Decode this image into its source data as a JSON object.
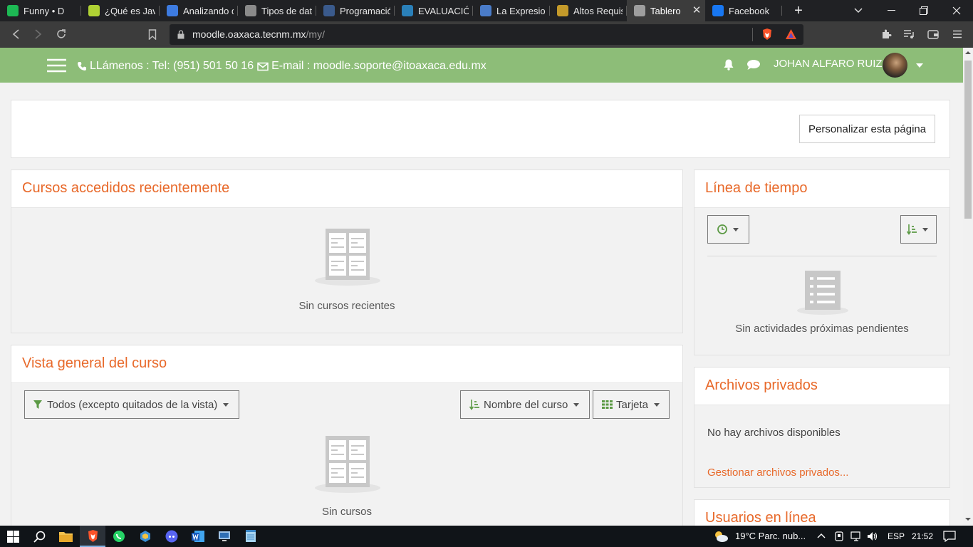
{
  "browser": {
    "tabs": [
      {
        "title": "Funny • D",
        "favicon": "spotify-icon",
        "color": "#1db954"
      },
      {
        "title": "¿Qué es JavaS",
        "favicon": "diamond-icon",
        "color": "#b0d234"
      },
      {
        "title": "Analizando di",
        "favicon": "s-logo-icon",
        "color": "#3d7be0"
      },
      {
        "title": "Tipos de dato",
        "favicon": "globe-icon",
        "color": "#8a8a8a"
      },
      {
        "title": "Programación",
        "favicon": "page-icon",
        "color": "#3a5a8c"
      },
      {
        "title": "EVALUACIÓN",
        "favicon": "wordpress-icon",
        "color": "#2a80b9"
      },
      {
        "title": "La Expresion:",
        "favicon": "doc-icon",
        "color": "#4a7cc9"
      },
      {
        "title": "Altos Requisit",
        "favicon": "badge-icon",
        "color": "#c49a2a"
      },
      {
        "title": "Tablero",
        "favicon": "moodle-icon",
        "color": "#9e9e9e",
        "active": true
      },
      {
        "title": "Facebook",
        "favicon": "facebook-icon",
        "color": "#1877f2"
      }
    ],
    "url_host": "moodle.oaxaca.tecnm.mx",
    "url_path": "/my/"
  },
  "header": {
    "phone_text": "LLámenos : Tel: (951) 501 50 16",
    "email_text": "E-mail : moodle.soporte@itoaxaca.edu.mx",
    "user_name": "JOHAN ALFARO RUIZ"
  },
  "customize_label": "Personalizar esta página",
  "recent": {
    "title": "Cursos accedidos recientemente",
    "empty_text": "Sin cursos recientes"
  },
  "overview": {
    "title": "Vista general del curso",
    "filter_label": "Todos (excepto quitados de la vista)",
    "sort_label": "Nombre del curso",
    "view_label": "Tarjeta",
    "empty_text": "Sin cursos"
  },
  "timeline": {
    "title": "Línea de tiempo",
    "empty_text": "Sin actividades próximas pendientes"
  },
  "files": {
    "title": "Archivos privados",
    "empty_text": "No hay archivos disponibles",
    "manage_link": "Gestionar archivos privados..."
  },
  "online": {
    "title": "Usuarios en línea"
  },
  "taskbar": {
    "weather": "19°C  Parc. nub...",
    "lang": "ESP",
    "time": "21:52"
  },
  "colors": {
    "header": "#8dbd78",
    "accent": "#e8692a",
    "filter_icon": "#5c9a45"
  }
}
